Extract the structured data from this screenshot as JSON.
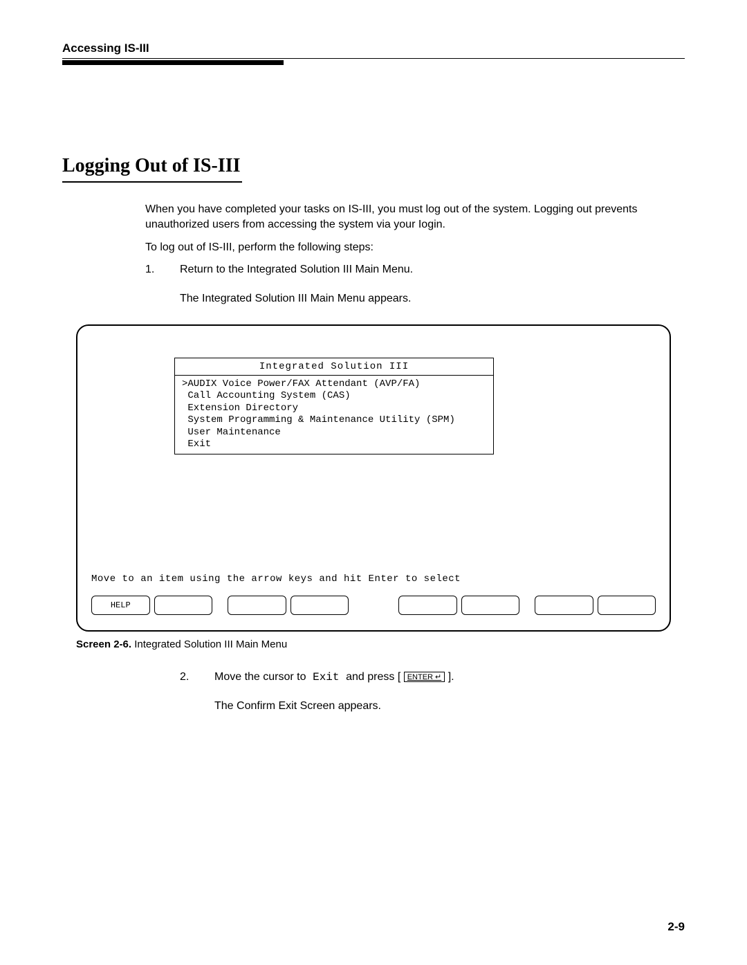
{
  "header": {
    "running_head": "Accessing IS-III"
  },
  "heading": "Logging Out of IS-III",
  "intro": {
    "para1": "When you have completed your tasks on IS-III, you must log out of the system. Logging out prevents unauthorized users from accessing the system via your Iogin.",
    "para2": "To log out of IS-III, perform the following steps:"
  },
  "steps": {
    "s1_num": "1.",
    "s1_text": "Return to the Integrated Solution III Main Menu.",
    "s1_result": "The Integrated Solution III Main Menu appears.",
    "s2_num": "2.",
    "s2_pre": "Move the cursor to",
    "s2_code": " Exit ",
    "s2_mid": " and press [ ",
    "s2_key": "ENTER ↵",
    "s2_post": " ].",
    "s2_result": "The Confirm Exit Screen appears."
  },
  "screen": {
    "title": "Integrated Solution III",
    "items": ">AUDIX Voice Power/FAX Attendant (AVP/FA)\n Call Accounting System (CAS)\n Extension Directory\n System Programming & Maintenance Utility (SPM)\n User Maintenance\n Exit",
    "hint": "Move to an item using the arrow keys and hit Enter to select",
    "fkeys": {
      "f1": "HELP",
      "f2": "",
      "f3": "",
      "f4": "",
      "f5": "",
      "f6": "",
      "f7": "",
      "f8": ""
    }
  },
  "caption": {
    "label": "Screen 2-6.",
    "text": " Integrated Solution III Main Menu"
  },
  "page_number": "2-9"
}
